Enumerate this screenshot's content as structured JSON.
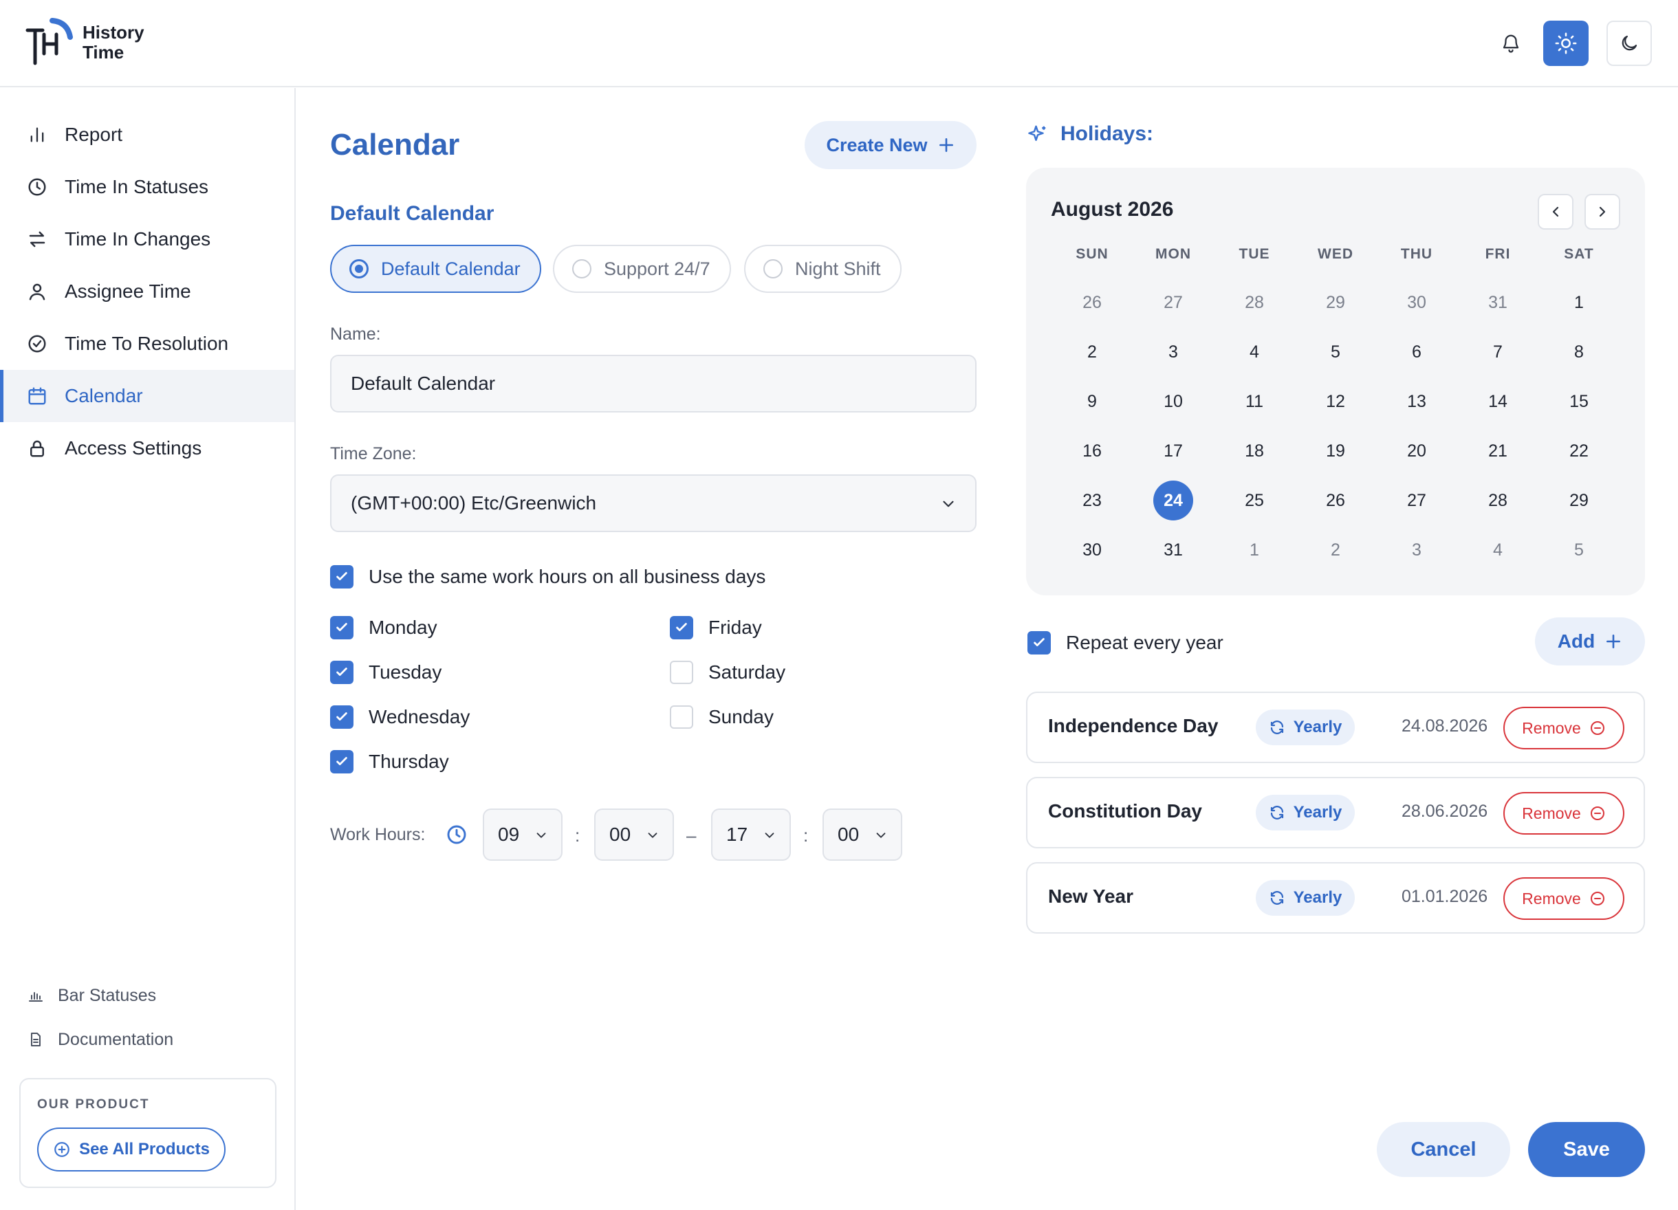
{
  "app": {
    "name_line1": "History",
    "name_line2": "Time"
  },
  "colors": {
    "accent": "#3b73d1",
    "accent_light": "#eaf0fa",
    "danger": "#d9343a",
    "text": "#1f2430",
    "muted": "#5b6170"
  },
  "header": {
    "icons": [
      "bell-icon",
      "sun-icon",
      "moon-icon"
    ]
  },
  "sidebar": {
    "items": [
      {
        "label": "Report",
        "icon": "bar-chart-icon"
      },
      {
        "label": "Time In Statuses",
        "icon": "clock-icon"
      },
      {
        "label": "Time In Changes",
        "icon": "swap-arrows-icon"
      },
      {
        "label": "Assignee Time",
        "icon": "user-icon"
      },
      {
        "label": "Time To Resolution",
        "icon": "check-circle-icon"
      },
      {
        "label": "Calendar",
        "icon": "calendar-icon",
        "active": true
      },
      {
        "label": "Access Settings",
        "icon": "lock-icon"
      }
    ],
    "bottom_links": [
      {
        "label": "Bar Statuses",
        "icon": "bar-chart-icon"
      },
      {
        "label": "Documentation",
        "icon": "document-icon"
      }
    ],
    "product": {
      "label": "OUR PRODUCT",
      "button": "See All Products"
    }
  },
  "main": {
    "title": "Calendar",
    "create_new": "Create New",
    "subtitle": "Default Calendar",
    "calendars": [
      "Default Calendar",
      "Support 24/7",
      "Night Shift"
    ],
    "selected_calendar": "Default Calendar",
    "name_label": "Name:",
    "name_value": "Default Calendar",
    "timezone_label": "Time Zone:",
    "timezone_value": "(GMT+00:00) Etc/Greenwich",
    "same_hours": {
      "label": "Use the same work hours on all business days",
      "checked": true
    },
    "days": [
      {
        "label": "Monday",
        "checked": true
      },
      {
        "label": "Tuesday",
        "checked": true
      },
      {
        "label": "Wednesday",
        "checked": true
      },
      {
        "label": "Thursday",
        "checked": true
      },
      {
        "label": "Friday",
        "checked": true
      },
      {
        "label": "Saturday",
        "checked": false
      },
      {
        "label": "Sunday",
        "checked": false
      }
    ],
    "work_hours": {
      "label": "Work Hours:",
      "start_h": "09",
      "start_m": "00",
      "end_h": "17",
      "end_m": "00",
      "colon": ":",
      "dash": "–"
    }
  },
  "holidays": {
    "title": "Holidays:",
    "month": "August 2026",
    "weekdays": [
      "SUN",
      "MON",
      "TUE",
      "WED",
      "THU",
      "FRI",
      "SAT"
    ],
    "weeks": [
      [
        "26",
        "27",
        "28",
        "29",
        "30",
        "31",
        "1"
      ],
      [
        "2",
        "3",
        "4",
        "5",
        "6",
        "7",
        "8"
      ],
      [
        "9",
        "10",
        "11",
        "12",
        "13",
        "14",
        "15"
      ],
      [
        "16",
        "17",
        "18",
        "19",
        "20",
        "21",
        "22"
      ],
      [
        "23",
        "24",
        "25",
        "26",
        "27",
        "28",
        "29"
      ],
      [
        "30",
        "31",
        "1",
        "2",
        "3",
        "4",
        "5"
      ]
    ],
    "selected_day": "24",
    "repeat": {
      "label": "Repeat every year",
      "checked": true
    },
    "add": "Add",
    "list": [
      {
        "name": "Independence Day",
        "badge": "Yearly",
        "date": "24.08.2026",
        "remove": "Remove"
      },
      {
        "name": "Constitution Day",
        "badge": "Yearly",
        "date": "28.06.2026",
        "remove": "Remove"
      },
      {
        "name": "New Year",
        "badge": "Yearly",
        "date": "01.01.2026",
        "remove": "Remove"
      }
    ]
  },
  "footer": {
    "cancel": "Cancel",
    "save": "Save"
  }
}
